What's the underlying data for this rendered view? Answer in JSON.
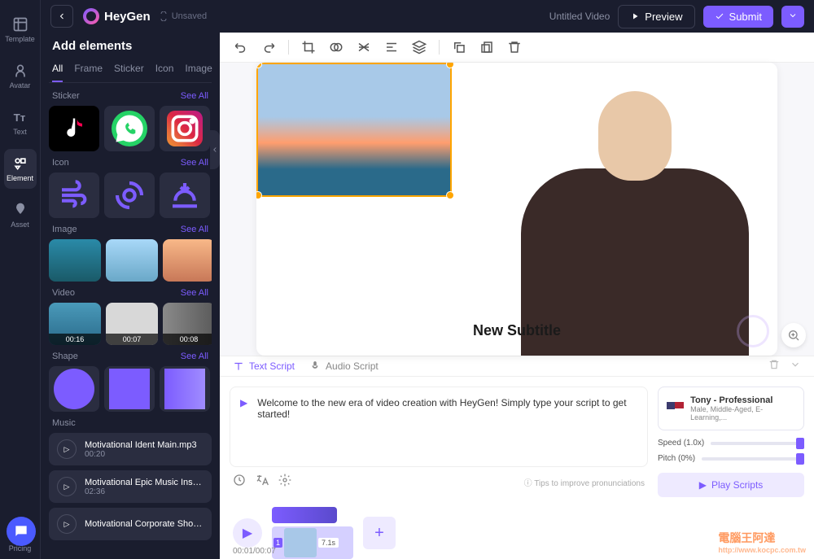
{
  "header": {
    "logo": "HeyGen",
    "unsaved": "Unsaved",
    "untitled": "Untitled Video",
    "preview": "Preview",
    "submit": "Submit"
  },
  "rail": {
    "template": "Template",
    "avatar": "Avatar",
    "text": "Text",
    "element": "Element",
    "asset": "Asset",
    "pricing": "Pricing"
  },
  "sidebar": {
    "title": "Add elements",
    "tabs": {
      "all": "All",
      "frame": "Frame",
      "sticker": "Sticker",
      "icon": "Icon",
      "image": "Image"
    },
    "see_all": "See All",
    "sections": {
      "sticker": "Sticker",
      "icon": "Icon",
      "image": "Image",
      "video": "Video",
      "shape": "Shape",
      "music": "Music"
    },
    "videos": [
      {
        "dur": "00:16"
      },
      {
        "dur": "00:07"
      },
      {
        "dur": "00:08"
      }
    ],
    "music": [
      {
        "title": "Motivational Ident Main.mp3",
        "dur": "00:20"
      },
      {
        "title": "Motivational Epic Music Inspirin",
        "dur": "02:36"
      },
      {
        "title": "Motivational Corporate Short...",
        "dur": ""
      }
    ]
  },
  "canvas": {
    "subtitle": "New Subtitle"
  },
  "script": {
    "text_tab": "Text Script",
    "audio_tab": "Audio Script",
    "content": "Welcome to the new era of video creation with HeyGen! Simply type your script to get started!",
    "tip": "Tips to improve pronunciations"
  },
  "voice": {
    "name": "Tony - Professional",
    "meta": "Male, Middle-Aged, E-Learning,...",
    "speed": "Speed (1.0x)",
    "pitch": "Pitch (0%)",
    "play": "Play Scripts"
  },
  "timeline": {
    "clip_dur": "7.1s",
    "time": "00:01/00:07"
  },
  "footer": {
    "wm1": "電腦王阿達",
    "wm2": "http://www.kocpc.com.tw"
  }
}
